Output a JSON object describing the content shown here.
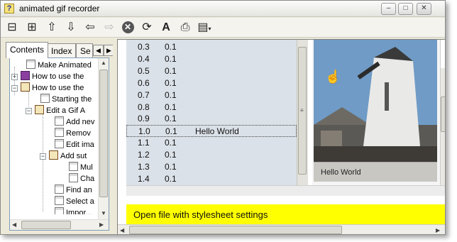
{
  "window": {
    "title": "animated gif recorder",
    "controls": {
      "minimize": "‒",
      "maximize": "□",
      "close": "✕"
    }
  },
  "toolbar": {
    "buttons": [
      {
        "name": "hide-tabs",
        "icon": "hide-pane-icon",
        "glyph": "⊟",
        "enabled": true
      },
      {
        "name": "locate",
        "icon": "locate-icon",
        "glyph": "⊞",
        "enabled": true
      },
      {
        "name": "previous",
        "icon": "arrow-up-icon",
        "glyph": "⇧",
        "enabled": true
      },
      {
        "name": "next",
        "icon": "arrow-down-icon",
        "glyph": "⇩",
        "enabled": true
      },
      {
        "name": "back",
        "icon": "arrow-left-icon",
        "glyph": "⇦",
        "enabled": true
      },
      {
        "name": "forward",
        "icon": "arrow-right-icon",
        "glyph": "⇨",
        "enabled": false
      },
      {
        "name": "stop",
        "icon": "stop-icon",
        "glyph": "✕",
        "enabled": true
      },
      {
        "name": "refresh",
        "icon": "refresh-icon",
        "glyph": "⟳",
        "enabled": true
      },
      {
        "name": "font",
        "icon": "font-size-icon",
        "glyph": "A",
        "enabled": true
      },
      {
        "name": "print",
        "icon": "printer-icon",
        "glyph": "⎙",
        "enabled": true
      },
      {
        "name": "options",
        "icon": "options-icon",
        "glyph": "▤",
        "enabled": true
      }
    ]
  },
  "nav": {
    "tabs": [
      {
        "label": "Contents",
        "active": true
      },
      {
        "label": "Index",
        "active": false
      },
      {
        "label": "Se",
        "active": false
      }
    ],
    "tree": [
      {
        "label": "Make Animated",
        "icon": "page",
        "expander": "",
        "indent": 0
      },
      {
        "label": "How to use the",
        "icon": "book",
        "expander": "+",
        "indent": 0
      },
      {
        "label": "How to use the",
        "icon": "bookopen",
        "expander": "−",
        "indent": 0
      },
      {
        "label": "Starting the",
        "icon": "page",
        "expander": "",
        "indent": 1
      },
      {
        "label": "Edit a Gif A",
        "icon": "bookopen",
        "expander": "−",
        "indent": 1
      },
      {
        "label": "Add nev",
        "icon": "page",
        "expander": "",
        "indent": 2
      },
      {
        "label": "Remov",
        "icon": "page",
        "expander": "",
        "indent": 2
      },
      {
        "label": "Edit ima",
        "icon": "page",
        "expander": "",
        "indent": 2
      },
      {
        "label": "Add sut",
        "icon": "bookopen",
        "expander": "−",
        "indent": 2
      },
      {
        "label": "Mul",
        "icon": "page",
        "expander": "",
        "indent": 3
      },
      {
        "label": "Cha",
        "icon": "page",
        "expander": "",
        "indent": 3
      },
      {
        "label": "Find an",
        "icon": "page",
        "expander": "",
        "indent": 2
      },
      {
        "label": "Select a",
        "icon": "page",
        "expander": "",
        "indent": 2
      },
      {
        "label": "Impor...",
        "icon": "page",
        "expander": "",
        "indent": 2
      }
    ]
  },
  "frames": {
    "rows": [
      {
        "time": "0.3",
        "delay": "0.1",
        "text": ""
      },
      {
        "time": "0.4",
        "delay": "0.1",
        "text": ""
      },
      {
        "time": "0.5",
        "delay": "0.1",
        "text": ""
      },
      {
        "time": "0.6",
        "delay": "0.1",
        "text": ""
      },
      {
        "time": "0.7",
        "delay": "0.1",
        "text": ""
      },
      {
        "time": "0.8",
        "delay": "0.1",
        "text": ""
      },
      {
        "time": "0.9",
        "delay": "0.1",
        "text": ""
      },
      {
        "time": "1.0",
        "delay": "0.1",
        "text": "Hello World"
      },
      {
        "time": "1.1",
        "delay": "0.1",
        "text": ""
      },
      {
        "time": "1.2",
        "delay": "0.1",
        "text": ""
      },
      {
        "time": "1.3",
        "delay": "0.1",
        "text": ""
      },
      {
        "time": "1.4",
        "delay": "0.1",
        "text": ""
      }
    ],
    "focused_index": 7
  },
  "preview": {
    "caption": "Hello World"
  },
  "banner": {
    "text": "Open file with stylesheet settings",
    "color": "#ffff00"
  }
}
